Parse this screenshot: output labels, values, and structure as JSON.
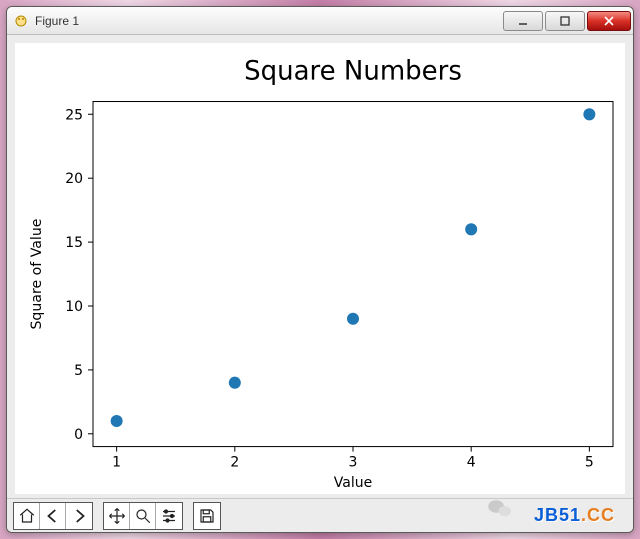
{
  "window": {
    "title": "Figure 1"
  },
  "toolbar": {
    "home": "Home",
    "back": "Back",
    "forward": "Forward",
    "pan": "Pan",
    "zoom": "Zoom",
    "subplots": "Configure subplots",
    "save": "Save"
  },
  "watermark": {
    "brand_left": "JB51",
    "brand_right": ".CC"
  },
  "chart_data": {
    "type": "scatter",
    "title": "Square Numbers",
    "xlabel": "Value",
    "ylabel": "Square of Value",
    "x": [
      1,
      2,
      3,
      4,
      5
    ],
    "y": [
      1,
      4,
      9,
      16,
      25
    ],
    "xticks": [
      1,
      2,
      3,
      4,
      5
    ],
    "yticks": [
      0,
      5,
      10,
      15,
      20,
      25
    ],
    "xlim": [
      0.8,
      5.2
    ],
    "ylim": [
      -1,
      26
    ],
    "marker_color": "#1f77b4",
    "marker_radius": 6
  }
}
